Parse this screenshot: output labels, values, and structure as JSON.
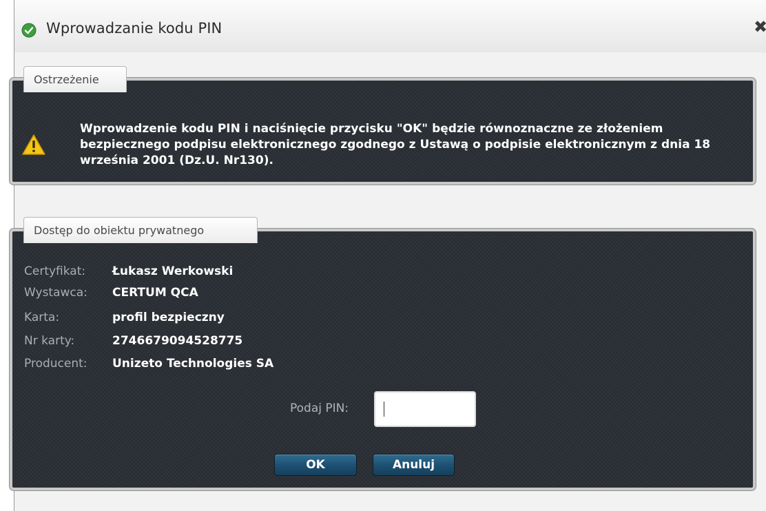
{
  "window": {
    "title": "Wprowadzanie kodu PIN",
    "close_symbol": "✖"
  },
  "warning": {
    "tab_label": "Ostrzeżenie",
    "icon": "warning-triangle-icon",
    "text": "Wprowadzenie kodu PIN i naciśnięcie przycisku \"OK\" będzie równoznaczne ze złożeniem bezpiecznego podpisu elektronicznego zgodnego z Ustawą o podpisie elektronicznym z dnia 18 września 2001 (Dz.U. Nr130)."
  },
  "access": {
    "tab_label": "Dostęp do obiektu prywatnego",
    "fields": [
      {
        "label": "Certyfikat:",
        "value": "Łukasz Werkowski"
      },
      {
        "label": "Wystawca:",
        "value": "CERTUM QCA"
      },
      {
        "label": "Karta:",
        "value": "profil bezpieczny"
      },
      {
        "label": "Nr karty:",
        "value": "2746679094528775"
      },
      {
        "label": "Producent:",
        "value": "Unizeto Technologies SA"
      }
    ],
    "pin_label": "Podaj PIN:",
    "pin_value": "",
    "ok_label": "OK",
    "cancel_label": "Anuluj"
  },
  "colors": {
    "panel_bg": "#2b3036",
    "button_blue": "#1c4f71",
    "label_gray": "#a7aeb5",
    "warning_yellow": "#f5c518",
    "app_icon_green": "#3f9d3f"
  }
}
